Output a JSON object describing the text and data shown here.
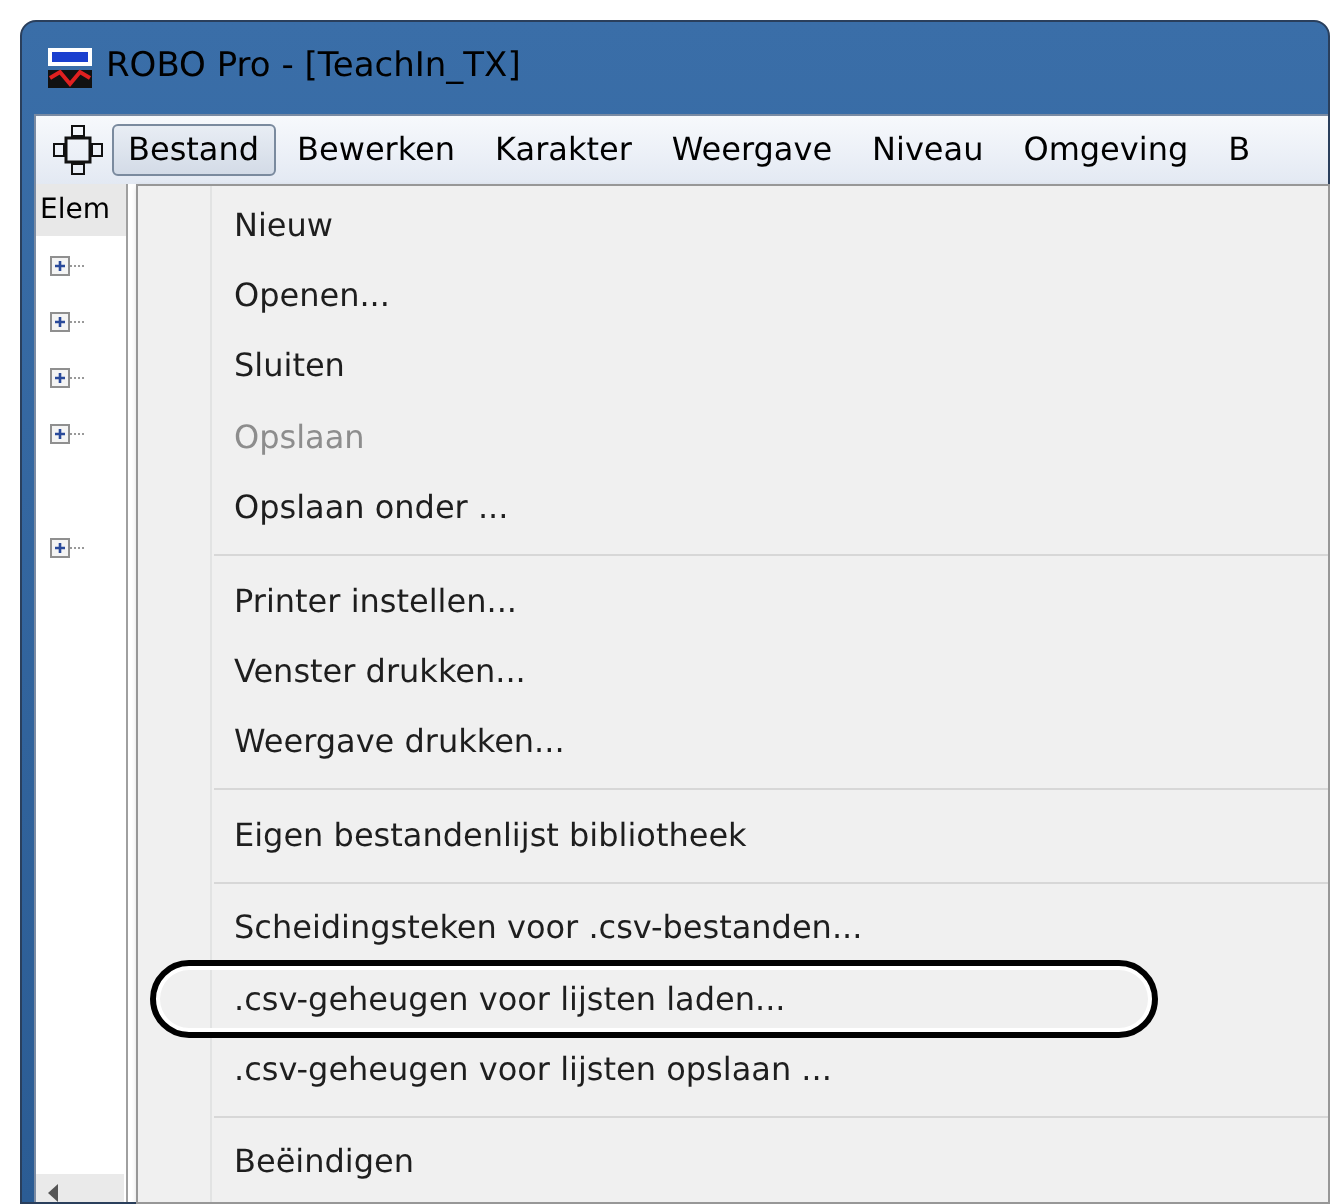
{
  "window": {
    "title": "ROBO Pro - [TeachIn_TX]"
  },
  "menubar": [
    {
      "label": "Bestand",
      "selected": true
    },
    {
      "label": "Bewerken",
      "selected": false
    },
    {
      "label": "Karakter",
      "selected": false
    },
    {
      "label": "Weergave",
      "selected": false
    },
    {
      "label": "Niveau",
      "selected": false
    },
    {
      "label": "Omgeving",
      "selected": false
    },
    {
      "label": "B",
      "selected": false
    }
  ],
  "side_panel": {
    "header": "Elem",
    "tree": [
      {
        "expanded": false
      },
      {
        "expanded": false
      },
      {
        "expanded": false
      },
      {
        "expanded": false
      },
      {
        "expanded": false
      }
    ]
  },
  "menu": [
    {
      "kind": "item",
      "label": "Nieuw",
      "disabled": false
    },
    {
      "kind": "item",
      "label": "Openen...",
      "disabled": false
    },
    {
      "kind": "item",
      "label": "Sluiten",
      "disabled": false
    },
    {
      "kind": "item",
      "label": "Opslaan",
      "disabled": true
    },
    {
      "kind": "item",
      "label": "Opslaan onder ...",
      "disabled": false
    },
    {
      "kind": "separator"
    },
    {
      "kind": "item",
      "label": "Printer instellen...",
      "disabled": false
    },
    {
      "kind": "item",
      "label": "Venster drukken...",
      "disabled": false
    },
    {
      "kind": "item",
      "label": "Weergave drukken...",
      "disabled": false
    },
    {
      "kind": "separator"
    },
    {
      "kind": "item",
      "label": "Eigen bestandenlijst bibliotheek",
      "disabled": false
    },
    {
      "kind": "separator"
    },
    {
      "kind": "item",
      "label": "Scheidingsteken voor .csv-bestanden...",
      "disabled": false
    },
    {
      "kind": "item",
      "label": ".csv-geheugen voor lijsten laden...",
      "disabled": false,
      "highlighted": true
    },
    {
      "kind": "item",
      "label": ".csv-geheugen voor lijsten opslaan ...",
      "disabled": false
    },
    {
      "kind": "separator"
    },
    {
      "kind": "item",
      "label": "Beëindigen",
      "disabled": false
    }
  ]
}
